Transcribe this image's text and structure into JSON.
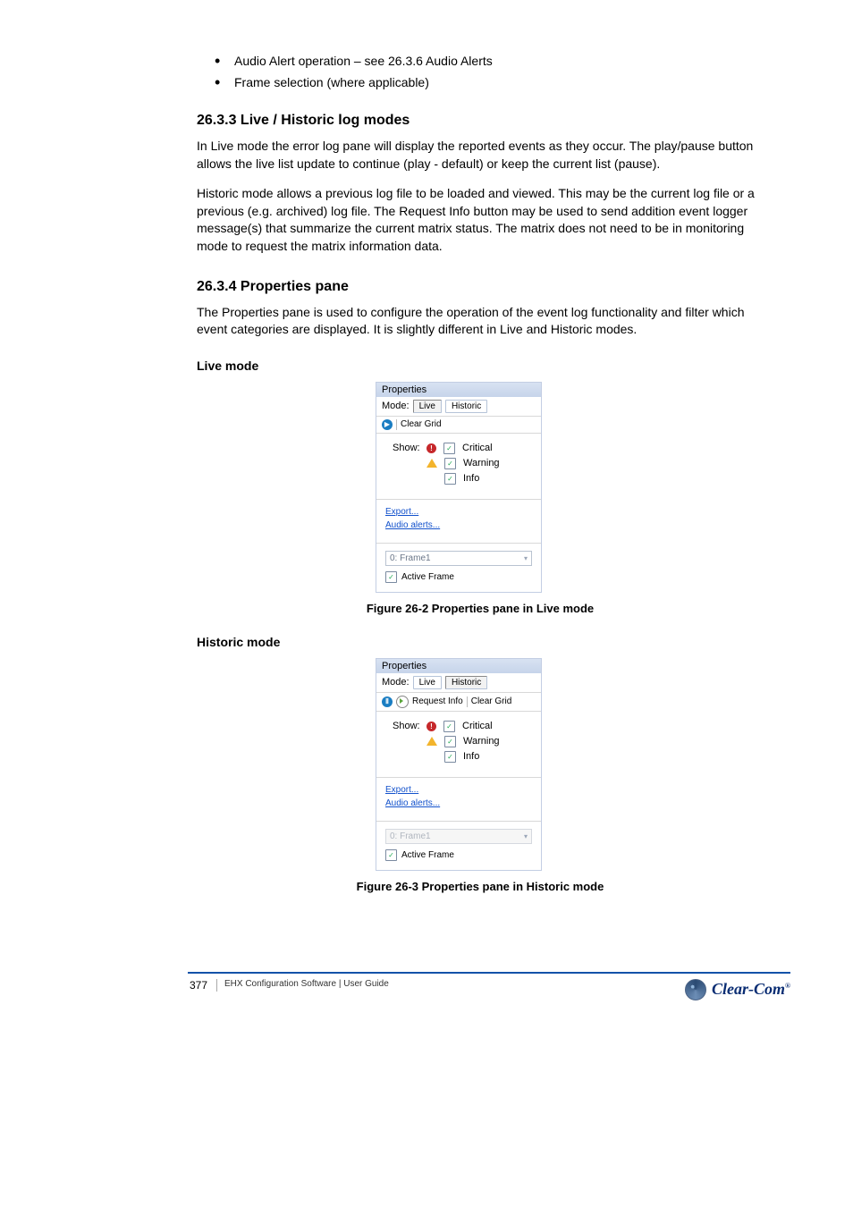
{
  "bullets": [
    "Audio Alert operation – see 26.3.6 Audio Alerts",
    "Frame selection (where applicable)"
  ],
  "sections": {
    "s1": {
      "title": "26.3.3 Live / Historic log modes",
      "paras": [
        "In Live mode the error log pane will display the reported events as they occur. The play/pause button allows the live list update to continue (play - default) or keep the current list (pause).",
        "Historic mode allows a previous log file to be loaded and viewed. This may be the current log file or a previous (e.g. archived) log file. The Request Info button may be used to send addition event logger message(s) that summarize the current matrix status. The matrix does not need to be in monitoring mode to request the matrix information data."
      ]
    },
    "s2": {
      "title": "26.3.4 Properties pane",
      "para": "The Properties pane is used to configure the operation of the event log functionality and filter which event categories are displayed. It is slightly different in Live and Historic modes."
    },
    "live_sub": "Live mode",
    "hist_sub": "Historic mode"
  },
  "panel": {
    "title": "Properties",
    "mode_label": "Mode:",
    "tabs": {
      "live": "Live",
      "historic": "Historic"
    },
    "clear_grid": "Clear Grid",
    "request_info": "Request Info",
    "show_label": "Show:",
    "levels": {
      "critical": "Critical",
      "warning": "Warning",
      "info": "Info"
    },
    "links": {
      "export": "Export...",
      "audio": "Audio alerts..."
    },
    "frame_value": "0: Frame1",
    "active_frame": "Active Frame"
  },
  "figcaptions": {
    "f1": "Figure 26-2 Properties pane in Live mode",
    "f2": "Figure 26-3 Properties pane in Historic mode"
  },
  "footer": {
    "page": "377",
    "doc": "EHX Configuration Software | User Guide",
    "brand": "Clear-Com"
  }
}
